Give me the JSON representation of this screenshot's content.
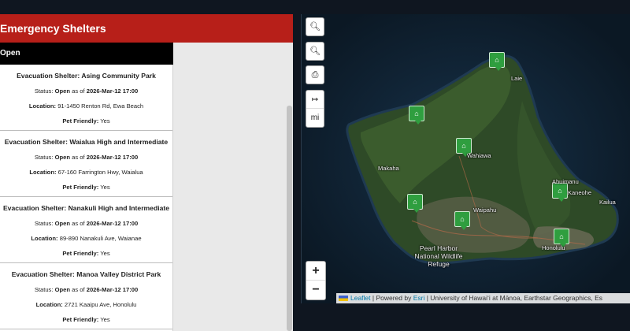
{
  "panel": {
    "title": "Emergency Shelters",
    "filter": "Open"
  },
  "shelters": [
    {
      "name": "Evacuation Shelter: Asing Community Park",
      "status_label": "Status:",
      "status": "Open",
      "as_of": "as of",
      "date": "2026-Mar-12 17:00",
      "location_label": "Location:",
      "location": "91-1450 Renton Rd, Ewa Beach",
      "pet_label": "Pet Friendly:",
      "pet": "Yes"
    },
    {
      "name": "Evacuation Shelter: Waialua High and Intermediate",
      "status_label": "Status:",
      "status": "Open",
      "as_of": "as of",
      "date": "2026-Mar-12 17:00",
      "location_label": "Location:",
      "location": "67-160 Farrington Hwy, Waialua",
      "pet_label": "Pet Friendly:",
      "pet": "Yes"
    },
    {
      "name": "Evacuation Shelter: Nanakuli High and Intermediate",
      "status_label": "Status:",
      "status": "Open",
      "as_of": "as of",
      "date": "2026-Mar-12 17:00",
      "location_label": "Location:",
      "location": "89-890 Nanakuli Ave, Waianae",
      "pet_label": "Pet Friendly:",
      "pet": "Yes"
    },
    {
      "name": "Evacuation Shelter: Manoa Valley District Park",
      "status_label": "Status:",
      "status": "Open",
      "as_of": "as of",
      "date": "2026-Mar-12 17:00",
      "location_label": "Location:",
      "location": "2721 Kaaipu Ave, Honolulu",
      "pet_label": "Pet Friendly:",
      "pet": "Yes"
    }
  ],
  "map": {
    "controls": {
      "search1_icon": "magnifier-icon",
      "search2_icon": "magnifier-icon",
      "print_icon": "printer-icon",
      "measure_icon": "arrow-right-icon",
      "unit": "mi",
      "zoom_in": "+",
      "zoom_out": "−"
    },
    "places": {
      "laie": "Laie",
      "wahiawa": "Wahiawa",
      "makaha": "Makaha",
      "ahuimanu": "Ahuimanu",
      "kaneohe": "Kaneohe",
      "kailua": "Kailua",
      "waipahu": "Waipahu",
      "pearl_harbor": "Pearl Harbor National Wildlife Refuge",
      "honolulu": "Honolulu"
    },
    "attribution": {
      "leaflet": "Leaflet",
      "sep1": " | Powered by ",
      "esri": "Esri",
      "rest": " | University of Hawaiʻi at Mānoa, Earthstar Geographics, Es"
    },
    "marker_color": "#2f9e3f",
    "header_color": "#b71f19"
  }
}
